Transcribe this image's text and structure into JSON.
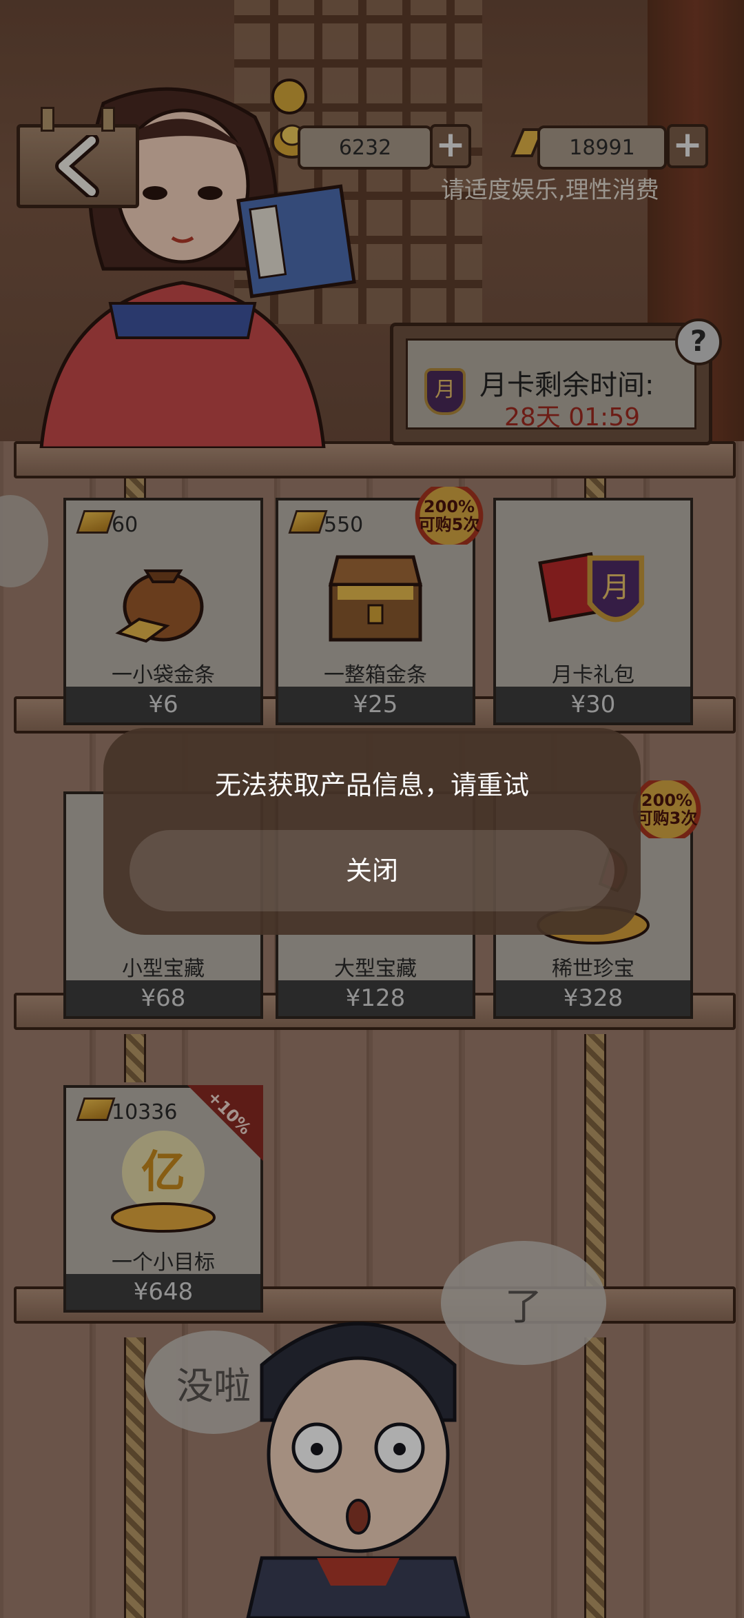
{
  "header": {
    "coins": "6232",
    "gold_bars": "18991",
    "notice": "请适度娱乐,理性消费"
  },
  "month_card": {
    "title": "月卡剩余时间:",
    "remaining": "28天 01:59",
    "help": "?"
  },
  "icons": {
    "back": "back-arrow-icon",
    "coin": "coin-icon",
    "gold_bar": "gold-bar-icon",
    "plus": "plus-icon",
    "help": "question-icon"
  },
  "shop": {
    "row1": [
      {
        "cost": "60",
        "name": "一小袋金条",
        "price": "¥6"
      },
      {
        "cost": "550",
        "name": "一整箱金条",
        "price": "¥25",
        "badge_line1": "200%",
        "badge_line2": "可购5次"
      },
      {
        "name": "月卡礼包",
        "price": "¥30"
      }
    ],
    "row2": [
      {
        "name": "小型宝藏",
        "price": "¥68"
      },
      {
        "name": "大型宝藏",
        "price": "¥128"
      },
      {
        "name": "稀世珍宝",
        "price": "¥328",
        "badge_line1": "200%",
        "badge_line2": "可购3次"
      }
    ],
    "row3": [
      {
        "cost": "10336",
        "name": "一个小目标",
        "price": "¥648",
        "tag": "+10%"
      }
    ]
  },
  "bubbles": {
    "left": "没啦",
    "right": "了"
  },
  "dialog": {
    "message": "无法获取产品信息，请重试",
    "close_label": "关闭"
  },
  "colors": {
    "price_bar": "#3d3d3d",
    "timer_red": "#a02a20",
    "badge_gold": "#d7a943",
    "tag_red": "#8a2a22"
  }
}
